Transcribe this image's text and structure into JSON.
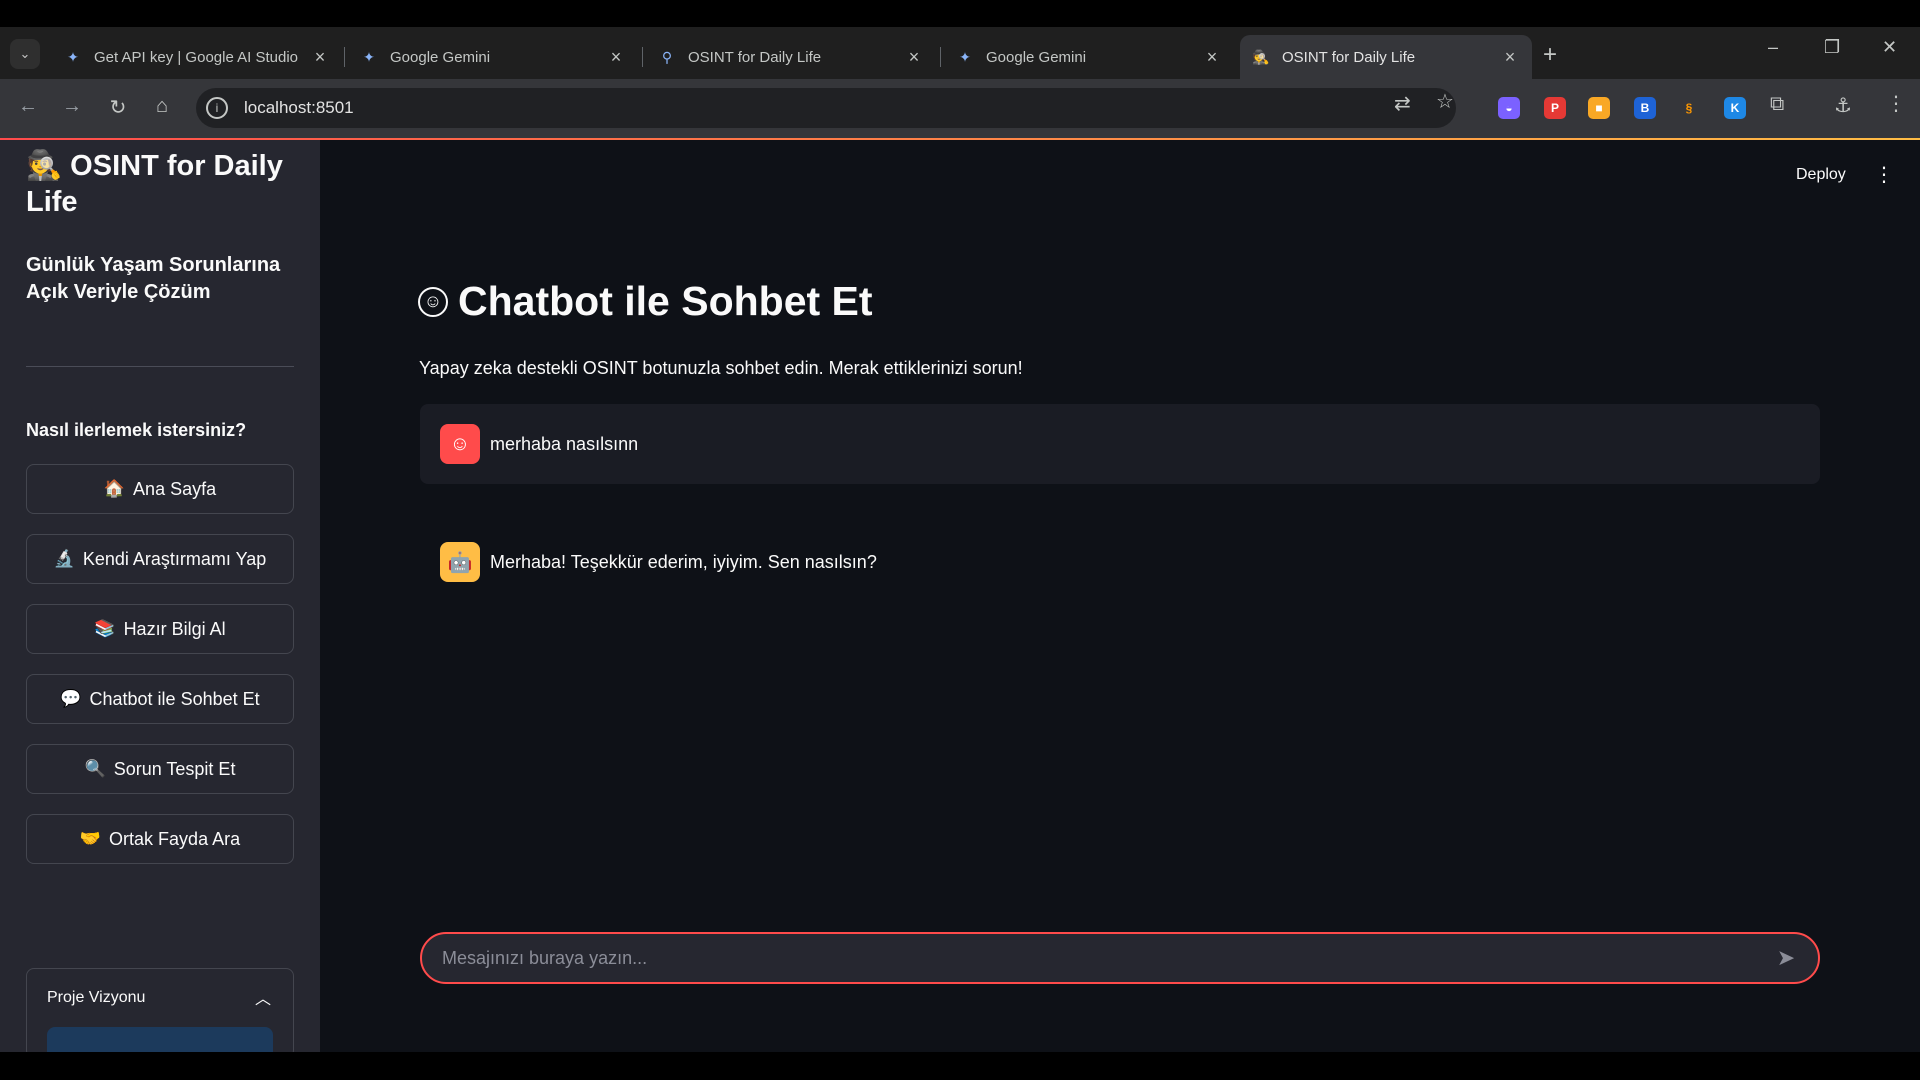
{
  "browser": {
    "tabs": [
      {
        "title": "Get API key | Google AI Studio",
        "icon": "ai-studio-icon"
      },
      {
        "title": "Google Gemini",
        "icon": "gemini-icon"
      },
      {
        "title": "OSINT for Daily Life",
        "icon": "search-icon"
      },
      {
        "title": "Google Gemini",
        "icon": "gemini-icon"
      },
      {
        "title": "OSINT for Daily Life",
        "icon": "detective-icon"
      }
    ],
    "url": "localhost:8501"
  },
  "app": {
    "title": "OSINT for Daily Life",
    "title_icon": "detective-icon",
    "subtitle": "Günlük Yaşam Sorunlarına Açık Veriyle Çözüm",
    "question": "Nasıl ilerlemek istersiniz?",
    "nav": [
      {
        "icon": "home-icon",
        "label": "Ana Sayfa"
      },
      {
        "icon": "microscope-icon",
        "label": "Kendi Araştırmamı Yap"
      },
      {
        "icon": "books-icon",
        "label": "Hazır Bilgi Al"
      },
      {
        "icon": "speech-bubble-icon",
        "label": "Chatbot ile Sohbet Et"
      },
      {
        "icon": "magnifier-icon",
        "label": "Sorun Tespit Et"
      },
      {
        "icon": "handshake-icon",
        "label": "Ortak Fayda Ara"
      }
    ],
    "expander_label": "Proje Vizyonu",
    "deploy_label": "Deploy",
    "main": {
      "title": "Chatbot ile Sohbet Et",
      "caption": "Yapay zeka destekli OSINT botunuzla sohbet edin. Merak ettiklerinizi sorun!",
      "messages": [
        {
          "role": "user",
          "text": "merhaba nasılsınn"
        },
        {
          "role": "assistant",
          "text": "Merhaba! Teşekkür ederim, iyiyim. Sen nasılsın?"
        }
      ],
      "input_placeholder": "Mesajınızı buraya yazın..."
    }
  },
  "colors": {
    "accent": "#ff4b4b",
    "bot_avatar": "#ffbd45",
    "app_bg": "#0e1117",
    "sidebar_bg": "#262730"
  }
}
